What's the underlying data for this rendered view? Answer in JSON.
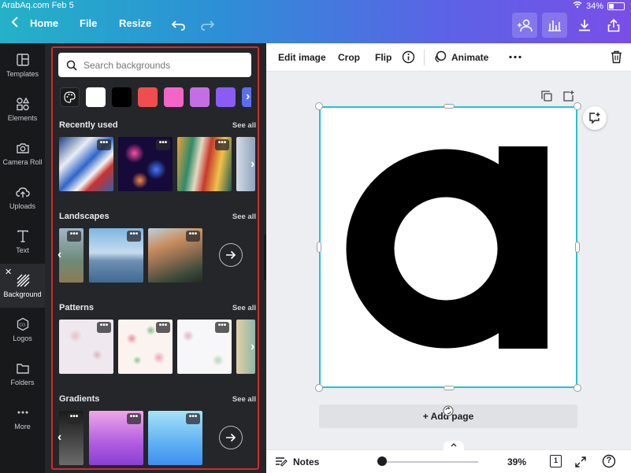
{
  "status": {
    "left": "ArabAq.com Feb 5",
    "battery": "34%"
  },
  "topbar": {
    "home_label": "Home",
    "file_label": "File",
    "resize_label": "Resize"
  },
  "rail": {
    "items": [
      {
        "label": "Templates"
      },
      {
        "label": "Elements"
      },
      {
        "label": "Camera Roll"
      },
      {
        "label": "Uploads"
      },
      {
        "label": "Text"
      },
      {
        "label": "Background"
      },
      {
        "label": "Logos"
      },
      {
        "label": "Folders"
      },
      {
        "label": "More"
      }
    ],
    "close_glyph": "✕"
  },
  "panel": {
    "search_placeholder": "Search backgrounds",
    "swatch_colors": [
      "#ffffff",
      "#000000",
      "#f04e4e",
      "#f565c8",
      "#c46ee6",
      "#8a5cf6",
      "#5b6ef2"
    ],
    "sections": [
      {
        "title": "Recently used",
        "see_all": "See all"
      },
      {
        "title": "Landscapes",
        "see_all": "See all"
      },
      {
        "title": "Patterns",
        "see_all": "See all"
      },
      {
        "title": "Gradients",
        "see_all": "See all"
      }
    ],
    "more_glyph": "•••"
  },
  "toolbar": {
    "edit_image": "Edit image",
    "crop": "Crop",
    "flip": "Flip",
    "animate": "Animate"
  },
  "canvas": {
    "glyph": "a",
    "add_page": "+ Add page"
  },
  "footer": {
    "notes": "Notes",
    "zoom": "39%",
    "page_number": "1",
    "help": "?",
    "zoom_level_fraction": 0.0
  },
  "colors": {
    "accent": "#26c1d6",
    "panel_bg": "#252629",
    "rail_bg": "#18191b",
    "highlight_frame": "#d42a2a"
  }
}
